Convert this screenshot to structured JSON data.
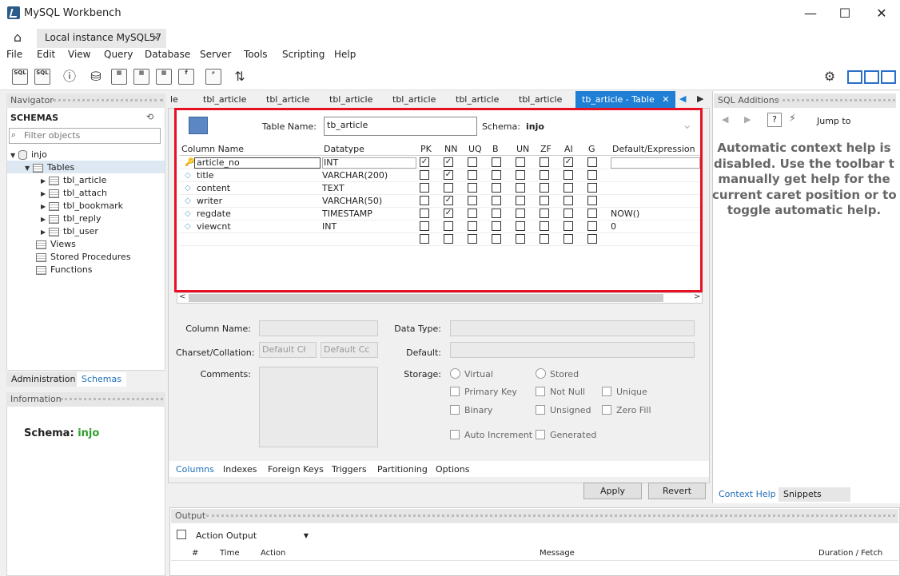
{
  "window": {
    "title": "MySQL Workbench",
    "minimize": "—",
    "maximize": "☐",
    "close": "✕"
  },
  "conn_tab": {
    "label": "Local instance MySQL57",
    "close": "×"
  },
  "menu": [
    "File",
    "Edit",
    "View",
    "Query",
    "Database",
    "Server",
    "Tools",
    "Scripting",
    "Help"
  ],
  "toolbar": {
    "sql1": "SQL",
    "sql2": "SQL"
  },
  "navigator": {
    "title": "Navigator",
    "schemas_label": "SCHEMAS",
    "filter_placeholder": "Filter objects",
    "schema": "injo",
    "tables_label": "Tables",
    "tables": [
      "tbl_article",
      "tbl_attach",
      "tbl_bookmark",
      "tbl_reply",
      "tbl_user"
    ],
    "views": "Views",
    "procs": "Stored Procedures",
    "funcs": "Functions",
    "tab_admin": "Administration",
    "tab_schemas": "Schemas"
  },
  "info": {
    "title": "Information",
    "schema_label": "Schema:",
    "schema_value": "injo"
  },
  "editor_tabs": [
    "le",
    "tbl_article",
    "tbl_article",
    "tbl_article",
    "tbl_article",
    "tbl_article",
    "tbl_article"
  ],
  "active_tab": {
    "label": "tb_article - Table",
    "close": "✕"
  },
  "table_editor": {
    "table_name_label": "Table Name:",
    "table_name": "tb_article",
    "schema_label": "Schema:",
    "schema": "injo"
  },
  "grid": {
    "headers": [
      "Column Name",
      "Datatype",
      "PK",
      "NN",
      "UQ",
      "B",
      "UN",
      "ZF",
      "AI",
      "G",
      "Default/Expression"
    ],
    "rows": [
      {
        "name": "article_no",
        "type": "INT",
        "flags": [
          1,
          1,
          0,
          0,
          0,
          0,
          1,
          0
        ],
        "default": ""
      },
      {
        "name": "title",
        "type": "VARCHAR(200)",
        "flags": [
          0,
          1,
          0,
          0,
          0,
          0,
          0,
          0
        ],
        "default": ""
      },
      {
        "name": "content",
        "type": "TEXT",
        "flags": [
          0,
          0,
          0,
          0,
          0,
          0,
          0,
          0
        ],
        "default": ""
      },
      {
        "name": "writer",
        "type": "VARCHAR(50)",
        "flags": [
          0,
          1,
          0,
          0,
          0,
          0,
          0,
          0
        ],
        "default": ""
      },
      {
        "name": "regdate",
        "type": "TIMESTAMP",
        "flags": [
          0,
          1,
          0,
          0,
          0,
          0,
          0,
          0
        ],
        "default": "NOW()"
      },
      {
        "name": "viewcnt",
        "type": "INT",
        "flags": [
          0,
          0,
          0,
          0,
          0,
          0,
          0,
          0
        ],
        "default": "0"
      }
    ]
  },
  "details": {
    "column_name": "Column Name:",
    "charset": "Charset/Collation:",
    "charset_ph": "Default Cł",
    "collation_ph": "Default Cc",
    "comments": "Comments:",
    "data_type": "Data Type:",
    "default": "Default:",
    "storage": "Storage:",
    "virtual": "Virtual",
    "stored": "Stored",
    "primary_key": "Primary Key",
    "not_null": "Not Null",
    "unique": "Unique",
    "binary": "Binary",
    "unsigned": "Unsigned",
    "zero_fill": "Zero Fill",
    "auto_increment": "Auto Increment",
    "generated": "Generated"
  },
  "bottom_tabs": [
    "Columns",
    "Indexes",
    "Foreign Keys",
    "Triggers",
    "Partitioning",
    "Options"
  ],
  "buttons": {
    "apply": "Apply",
    "revert": "Revert"
  },
  "sql_additions": {
    "title": "SQL Additions",
    "jump_to": "Jump to",
    "help_lines": [
      "Automatic context help is",
      "disabled. Use the toolbar t",
      "manually get help for the",
      "current caret position or to",
      "toggle automatic help."
    ],
    "tab_context": "Context Help",
    "tab_snippets": "Snippets"
  },
  "output": {
    "title": "Output",
    "selector": "Action Output",
    "cols": [
      "#",
      "Time",
      "Action",
      "Message",
      "Duration / Fetch"
    ]
  },
  "colors": {
    "accent": "#1e7fd4",
    "highlight": "#e81123",
    "schema_green": "#2e9e2e"
  }
}
